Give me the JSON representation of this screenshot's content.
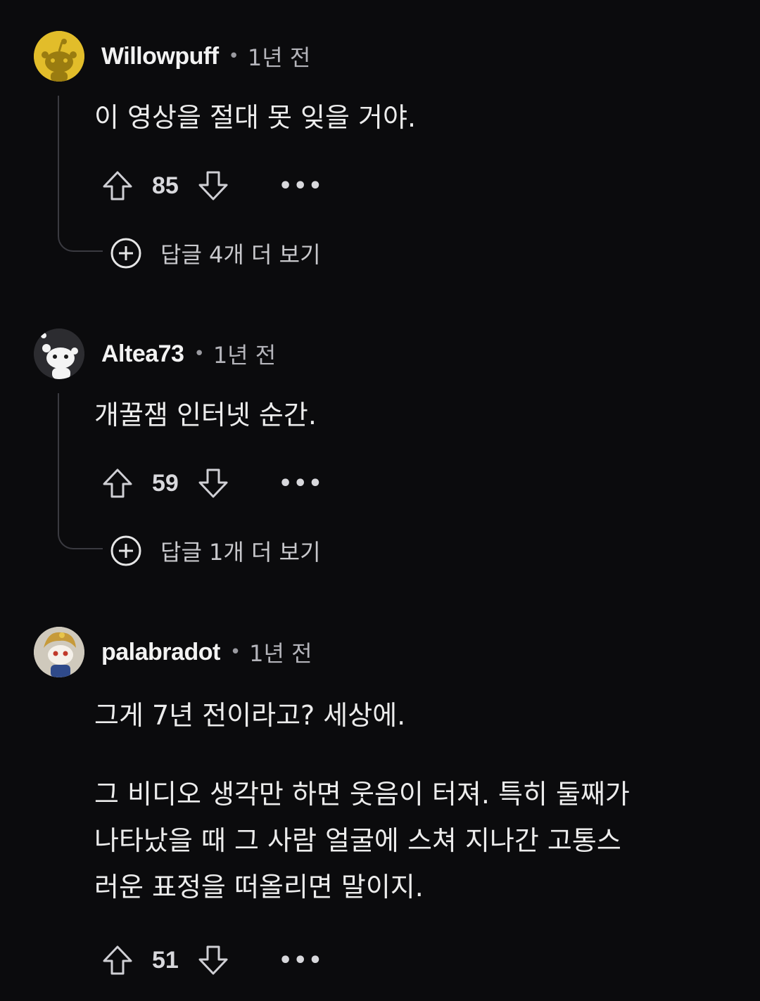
{
  "comments": [
    {
      "username": "Willowpuff",
      "separator": "•",
      "time": "1년 전",
      "paragraphs": [
        "이 영상을 절대 못 잊을 거야."
      ],
      "score": "85",
      "more_label": "•••",
      "replies_label": "답글 4개 더 보기",
      "avatar": "yellow-snoo-avatar"
    },
    {
      "username": "Altea73",
      "separator": "•",
      "time": "1년 전",
      "paragraphs": [
        "개꿀잼 인터넷 순간."
      ],
      "score": "59",
      "more_label": "•••",
      "replies_label": "답글 1개 더 보기",
      "avatar": "white-snoo-avatar"
    },
    {
      "username": "palabradot",
      "separator": "•",
      "time": "1년 전",
      "paragraphs": [
        "그게 7년 전이라고? 세상에.",
        "그 비디오 생각만 하면 웃음이 터져. 특히 둘째가\n나타났을 때 그 사람 얼굴에 스쳐 지나간 고통스\n러운 표정을 떠올리면 말이지."
      ],
      "score": "51",
      "more_label": "•••",
      "avatar": "custom-snoo-avatar"
    }
  ],
  "colors": {
    "background": "#0b0b0d",
    "text": "#ececec",
    "muted": "#b4b4ba",
    "thread_line": "#3a3a40"
  }
}
